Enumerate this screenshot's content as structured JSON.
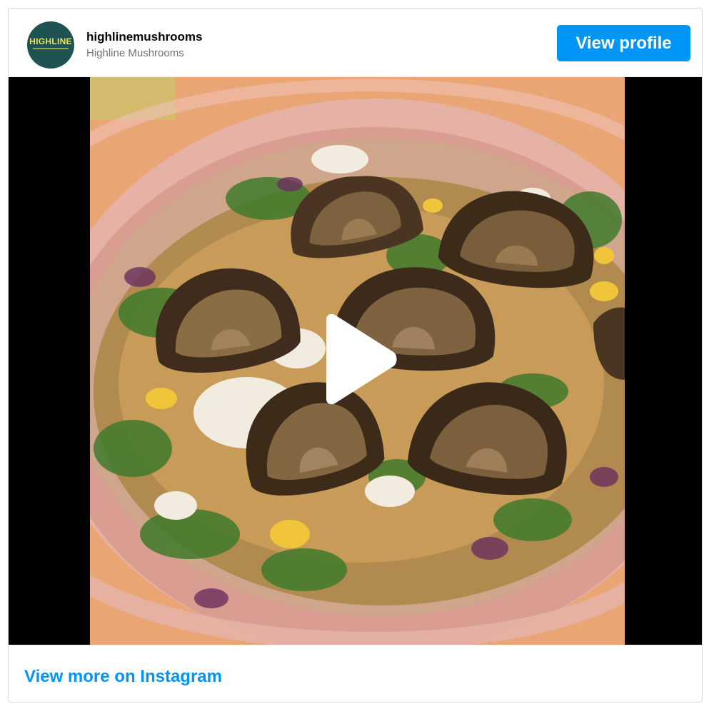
{
  "header": {
    "avatar_text": "HIGHLINE",
    "username": "highlinemushrooms",
    "display_name": "Highline Mushrooms",
    "view_profile_label": "View profile"
  },
  "media": {
    "type": "video",
    "play_icon": "play-icon"
  },
  "footer": {
    "view_more_label": "View more on Instagram"
  },
  "colors": {
    "accent": "#0095f6",
    "avatar_bg": "#1f5252",
    "avatar_text": "#e9e35a",
    "border": "#dbdbdb",
    "secondary_text": "#737373"
  }
}
